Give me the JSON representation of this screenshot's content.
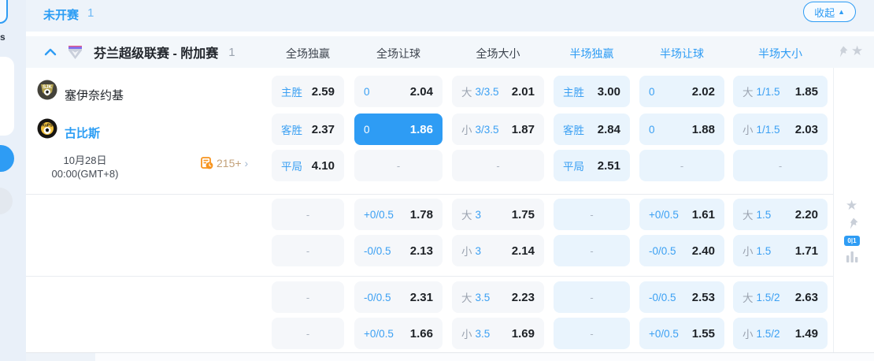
{
  "topbar": {
    "status": "未开赛",
    "status_count": "1",
    "collapse_label": "收起"
  },
  "league_header": {
    "title": "芬兰超级联赛 - 附加赛",
    "count": "1",
    "columns": [
      {
        "label": "全场独赢",
        "half": false
      },
      {
        "label": "全场让球",
        "half": false
      },
      {
        "label": "全场大小",
        "half": false
      },
      {
        "label": "半场独赢",
        "half": true
      },
      {
        "label": "半场让球",
        "half": true
      },
      {
        "label": "半场大小",
        "half": true
      }
    ]
  },
  "match": {
    "home_team": "塞伊奈约基",
    "away_team": "古比斯",
    "date_line1": "10月28日",
    "date_line2": "00:00(GMT+8)",
    "more_markets": "215+"
  },
  "odds": {
    "dash": "-",
    "rows": [
      {
        "cells": [
          {
            "label": "主胜",
            "value": "2.59"
          },
          {
            "label": "0",
            "value": "2.04"
          },
          {
            "pre": "大",
            "label": "3/3.5",
            "value": "2.01"
          },
          {
            "label": "主胜",
            "value": "3.00"
          },
          {
            "label": "0",
            "value": "2.02"
          },
          {
            "pre": "大",
            "label": "1/1.5",
            "value": "1.85"
          }
        ]
      },
      {
        "cells": [
          {
            "label": "客胜",
            "value": "2.37"
          },
          {
            "label": "0",
            "value": "1.86",
            "highlight": true
          },
          {
            "pre": "小",
            "label": "3/3.5",
            "value": "1.87"
          },
          {
            "label": "客胜",
            "value": "2.84"
          },
          {
            "label": "0",
            "value": "1.88"
          },
          {
            "pre": "小",
            "label": "1/1.5",
            "value": "2.03"
          }
        ]
      },
      {
        "cells": [
          {
            "label": "平局",
            "value": "4.10"
          },
          null,
          null,
          {
            "label": "平局",
            "value": "2.51"
          },
          null,
          null
        ]
      },
      {
        "cells": [
          null,
          {
            "label": "+0/0.5",
            "value": "1.78"
          },
          {
            "pre": "大",
            "label": "3",
            "value": "1.75"
          },
          null,
          {
            "label": "+0/0.5",
            "value": "1.61"
          },
          {
            "pre": "大",
            "label": "1.5",
            "value": "2.20"
          }
        ]
      },
      {
        "cells": [
          null,
          {
            "label": "-0/0.5",
            "value": "2.13"
          },
          {
            "pre": "小",
            "label": "3",
            "value": "2.14"
          },
          null,
          {
            "label": "-0/0.5",
            "value": "2.40"
          },
          {
            "pre": "小",
            "label": "1.5",
            "value": "1.71"
          }
        ]
      },
      {
        "cells": [
          null,
          {
            "label": "-0/0.5",
            "value": "2.31"
          },
          {
            "pre": "大",
            "label": "3.5",
            "value": "2.23"
          },
          null,
          {
            "label": "-0/0.5",
            "value": "2.53"
          },
          {
            "pre": "大",
            "label": "1.5/2",
            "value": "2.63"
          }
        ]
      },
      {
        "cells": [
          null,
          {
            "label": "+0/0.5",
            "value": "1.66"
          },
          {
            "pre": "小",
            "label": "3.5",
            "value": "1.69"
          },
          null,
          {
            "label": "+0/0.5",
            "value": "1.55"
          },
          {
            "pre": "小",
            "label": "1.5/2",
            "value": "1.49"
          }
        ]
      }
    ]
  },
  "rail": {
    "match_tracker_badge": "0|1"
  },
  "colors": {
    "accent": "#2e9cf4",
    "cell_bg": "#f5f7fa",
    "half_cell_bg": "#e9f4fd",
    "highlight_bg": "#2e9cf4"
  }
}
